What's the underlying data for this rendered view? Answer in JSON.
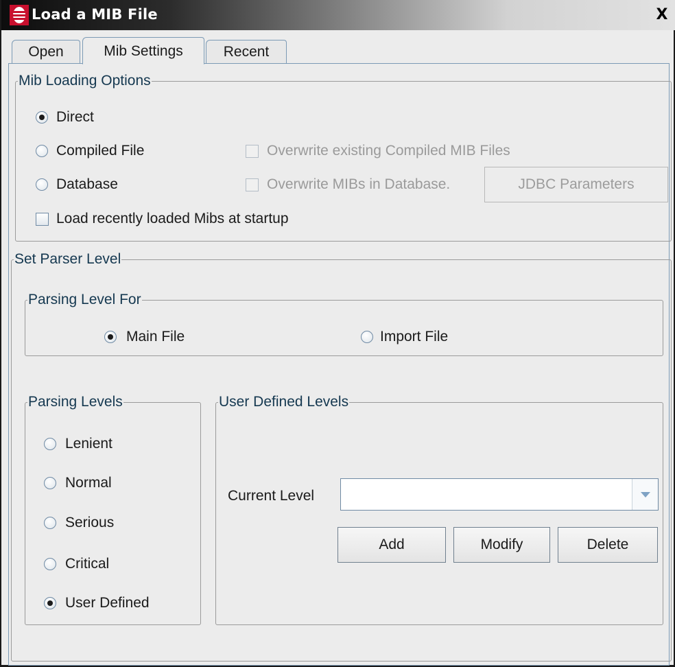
{
  "window": {
    "title": "Load a MIB File",
    "close_label": "X",
    "icon": "app-icon"
  },
  "tabs": [
    {
      "label": "Open",
      "active": false
    },
    {
      "label": "Mib Settings",
      "active": true
    },
    {
      "label": "Recent",
      "active": false
    }
  ],
  "mib_loading": {
    "legend": "Mib Loading Options",
    "direct": "Direct",
    "compiled_file": "Compiled File",
    "database": "Database",
    "selected": "Direct",
    "overwrite_compiled": "Overwrite existing Compiled MIB Files",
    "overwrite_database": "Overwrite MIBs in Database.",
    "jdbc_button": "JDBC Parameters",
    "load_recent": "Load recently loaded Mibs at startup"
  },
  "parser": {
    "legend": "Set Parser Level",
    "parsing_level_for": {
      "legend": "Parsing Level For",
      "main_file": "Main File",
      "import_file": "Import File",
      "selected": "Main File"
    },
    "parsing_levels": {
      "legend": "Parsing Levels",
      "items": [
        "Lenient",
        "Normal",
        "Serious",
        "Critical",
        "User Defined"
      ],
      "selected": "User Defined"
    },
    "user_defined": {
      "legend": "User Defined Levels",
      "current_level_label": "Current Level",
      "current_level_value": "",
      "add": "Add",
      "modify": "Modify",
      "delete": "Delete"
    }
  },
  "colors": {
    "accent_border": "#7b9ab5",
    "legend_text": "#153850",
    "app_icon": "#c8102e"
  }
}
